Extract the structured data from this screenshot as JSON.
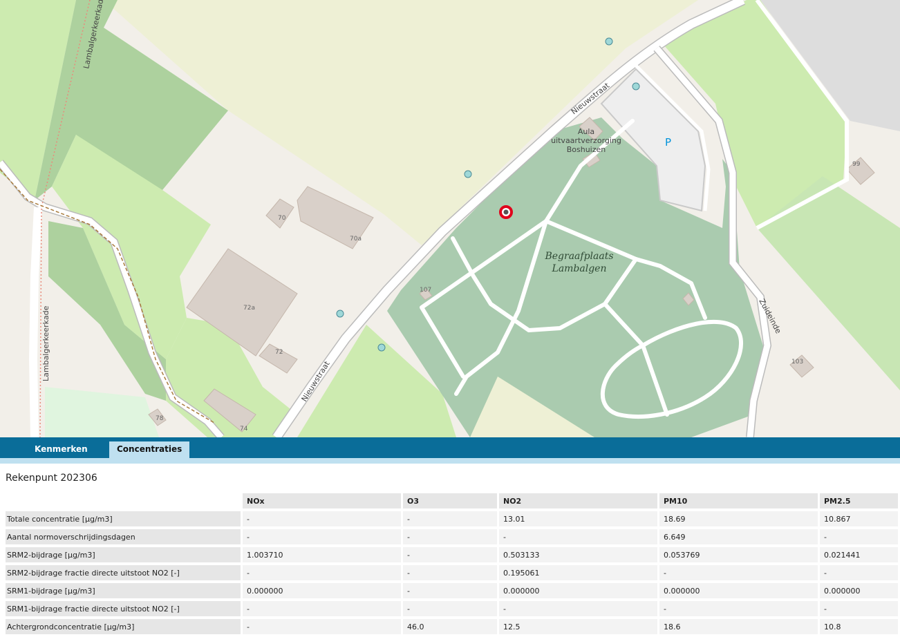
{
  "map": {
    "streets": {
      "nieuwstraat_upper": "Nieuwstraat",
      "nieuwstraat_lower": "Nieuwstraat",
      "lambalgerkeerkade_upper": "Lambalgerkeerkade",
      "lambalgerkeerkade_lower": "Lambalgerkeerkade",
      "zuideinde": "Zuideinde"
    },
    "places": {
      "aula_line1": "Aula",
      "aula_line2": "uitvaartverzorging",
      "aula_line3": "Boshuizen",
      "cemetery_line1": "Begraafplaats",
      "cemetery_line2": "Lambalgen",
      "parking": "P"
    },
    "house_numbers": [
      "70",
      "70a",
      "72a",
      "72",
      "78",
      "74",
      "107",
      "99",
      "103"
    ],
    "colors": {
      "background": "#f2efe9",
      "farmland": "#eef0d5",
      "grass": "#cdebb0",
      "forest": "#add19e",
      "cemetery": "#aacbaf",
      "building": "#d9d0c9",
      "road": "#ffffff",
      "marker": "#e0001b"
    }
  },
  "tabs": [
    {
      "label": "Kenmerken",
      "active": false
    },
    {
      "label": "Concentraties",
      "active": true
    }
  ],
  "panel": {
    "title": "Rekenpunt 202306",
    "columns": [
      "NOx",
      "O3",
      "NO2",
      "PM10",
      "PM2.5"
    ],
    "rows": [
      {
        "label": "Totale concentratie [µg/m3]",
        "values": [
          "-",
          "-",
          "13.01",
          "18.69",
          "10.867"
        ]
      },
      {
        "label": "Aantal normoverschrijdingsdagen",
        "values": [
          "-",
          "-",
          "-",
          "6.649",
          "-"
        ]
      },
      {
        "label": "SRM2-bijdrage [µg/m3]",
        "values": [
          "1.003710",
          "-",
          "0.503133",
          "0.053769",
          "0.021441"
        ]
      },
      {
        "label": "SRM2-bijdrage fractie directe uitstoot NO2 [-]",
        "values": [
          "-",
          "-",
          "0.195061",
          "-",
          "-"
        ]
      },
      {
        "label": "SRM1-bijdrage [µg/m3]",
        "values": [
          "0.000000",
          "-",
          "0.000000",
          "0.000000",
          "0.000000"
        ]
      },
      {
        "label": "SRM1-bijdrage fractie directe uitstoot NO2 [-]",
        "values": [
          "-",
          "-",
          "-",
          "-",
          "-"
        ]
      },
      {
        "label": "Achtergrondconcentratie [µg/m3]",
        "values": [
          "-",
          "46.0",
          "12.5",
          "18.6",
          "10.8"
        ]
      }
    ]
  }
}
